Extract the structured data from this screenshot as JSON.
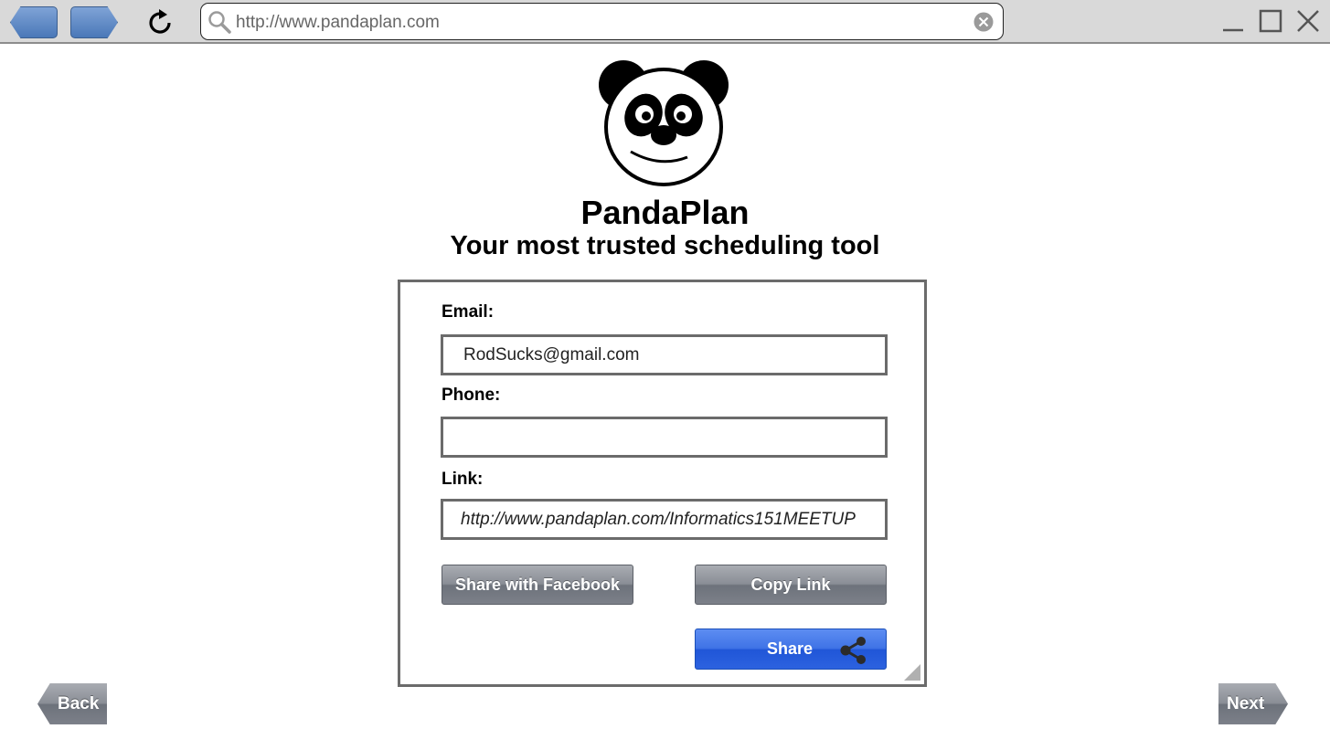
{
  "browser": {
    "url": "http://www.pandaplan.com",
    "icons": {
      "back": "back-arrow-icon",
      "forward": "forward-arrow-icon",
      "reload": "reload-icon",
      "search": "search-icon",
      "clear": "clear-icon",
      "minimize": "minimize-icon",
      "maximize": "maximize-icon",
      "close": "close-icon"
    }
  },
  "header": {
    "app_name": "PandaPlan",
    "tagline": "Your most trusted scheduling tool"
  },
  "form": {
    "email_label": "Email:",
    "email_value": "RodSucks@gmail.com",
    "phone_label": "Phone:",
    "phone_value": "",
    "link_label": "Link:",
    "link_value": "http://www.pandaplan.com/Informatics151MEETUP",
    "facebook_button": "Share with Facebook",
    "copy_button": "Copy Link",
    "share_button": "Share"
  },
  "footer": {
    "back_label": "Back",
    "next_label": "Next"
  },
  "colors": {
    "share_blue": "#2c62df",
    "button_grey": "#7c8089",
    "border_grey": "#6b6b6b",
    "nav_blue": "#4a78b8"
  }
}
